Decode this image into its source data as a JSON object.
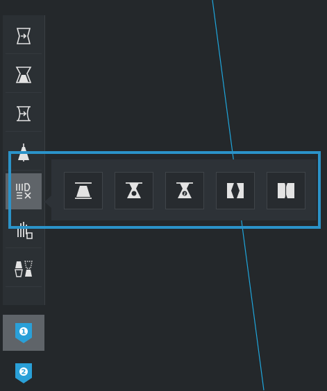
{
  "colors": {
    "background": "#24282b",
    "panel": "#2b3034",
    "active": "#5f6469",
    "icon": "#e3e3e3",
    "accent": "#2b93c9",
    "guide_line": "#1fa6dc"
  },
  "toolbar": {
    "tools": [
      {
        "icon": "taper-forward-icon"
      },
      {
        "icon": "taper-body-icon"
      },
      {
        "icon": "flex-taper-icon"
      },
      {
        "icon": "draft-tool-icon"
      },
      {
        "icon": "taper-type-menu-icon"
      },
      {
        "icon": "align-stack-icon"
      },
      {
        "icon": "pattern-pair-icon"
      }
    ],
    "markers": [
      {
        "label": "1",
        "icon": "marker-pin-1-icon"
      },
      {
        "label": "2",
        "icon": "marker-pin-2-icon"
      }
    ]
  },
  "flyout": {
    "options": [
      {
        "icon": "taper-top-icon"
      },
      {
        "icon": "taper-bottom-1-icon"
      },
      {
        "icon": "taper-bottom-2-icon"
      },
      {
        "icon": "taper-left-icon"
      },
      {
        "icon": "taper-both-sides-icon"
      }
    ]
  }
}
